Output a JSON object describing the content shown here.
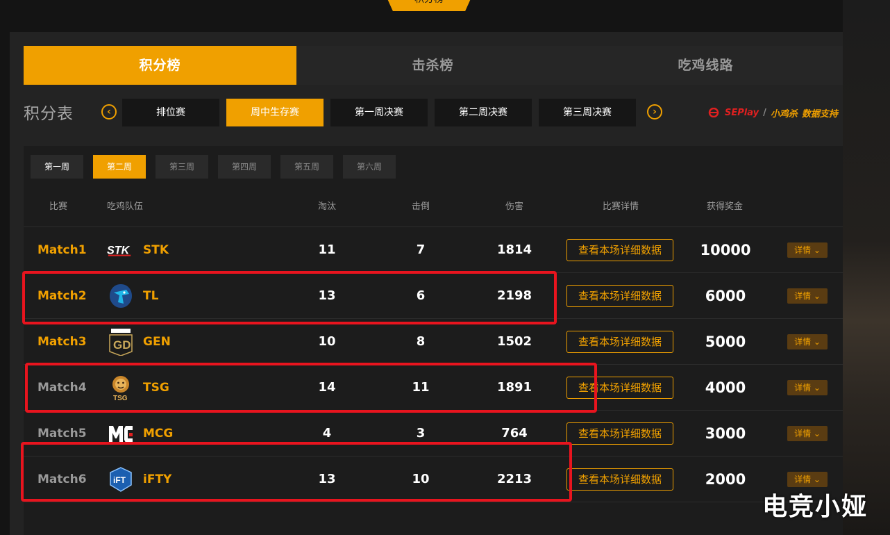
{
  "top_tab": {
    "label": "积分榜"
  },
  "main_tabs": [
    {
      "label": "积分榜",
      "active": true
    },
    {
      "label": "击杀榜",
      "active": false
    },
    {
      "label": "吃鸡线路",
      "active": false
    }
  ],
  "score_table": {
    "title": "积分表",
    "stage_tabs": [
      {
        "label": "排位赛",
        "active": false
      },
      {
        "label": "周中生存赛",
        "active": true
      },
      {
        "label": "第一周决赛",
        "active": false
      },
      {
        "label": "第二周决赛",
        "active": false
      },
      {
        "label": "第三周决赛",
        "active": false
      }
    ],
    "prev_icon": "chevron-left-icon",
    "next_icon": "chevron-right-icon",
    "sponsor": {
      "brand": "SEPlay",
      "partner": "小鸡杀",
      "tagline": "数据支持"
    }
  },
  "week_tabs": [
    {
      "label": "第一周",
      "active": false,
      "dim": false
    },
    {
      "label": "第二周",
      "active": true,
      "dim": false
    },
    {
      "label": "第三周",
      "active": false,
      "dim": true
    },
    {
      "label": "第四周",
      "active": false,
      "dim": true
    },
    {
      "label": "第五周",
      "active": false,
      "dim": true
    },
    {
      "label": "第六周",
      "active": false,
      "dim": true
    }
  ],
  "columns": {
    "match": "比赛",
    "team": "吃鸡队伍",
    "elim": "淘汰",
    "kill": "击倒",
    "damage": "伤害",
    "detail": "比赛详情",
    "prize": "获得奖金"
  },
  "rows": [
    {
      "match": "Match1",
      "team": "STK",
      "elim": "11",
      "kill": "7",
      "damage": "1814",
      "detail_label": "查看本场详细数据",
      "prize": "10000",
      "more_label": "详情 ⌄",
      "match_color": "gold",
      "logo": "stk-logo-icon"
    },
    {
      "match": "Match2",
      "team": "TL",
      "elim": "13",
      "kill": "6",
      "damage": "2198",
      "detail_label": "查看本场详细数据",
      "prize": "6000",
      "more_label": "详情 ⌄",
      "match_color": "gold",
      "logo": "tl-logo-icon"
    },
    {
      "match": "Match3",
      "team": "GEN",
      "elim": "10",
      "kill": "8",
      "damage": "1502",
      "detail_label": "查看本场详细数据",
      "prize": "5000",
      "more_label": "详情 ⌄",
      "match_color": "gold",
      "logo": "gen-logo-icon"
    },
    {
      "match": "Match4",
      "team": "TSG",
      "elim": "14",
      "kill": "11",
      "damage": "1891",
      "detail_label": "查看本场详细数据",
      "prize": "4000",
      "more_label": "详情 ⌄",
      "match_color": "grey",
      "logo": "tsg-logo-icon"
    },
    {
      "match": "Match5",
      "team": "MCG",
      "elim": "4",
      "kill": "3",
      "damage": "764",
      "detail_label": "查看本场详细数据",
      "prize": "3000",
      "more_label": "详情 ⌄",
      "match_color": "grey",
      "logo": "mcg-logo-icon"
    },
    {
      "match": "Match6",
      "team": "iFTY",
      "elim": "13",
      "kill": "10",
      "damage": "2213",
      "detail_label": "查看本场详细数据",
      "prize": "2000",
      "more_label": "详情 ⌄",
      "match_color": "grey",
      "logo": "ifty-logo-icon"
    }
  ],
  "watermark": "电竞小娅",
  "colors": {
    "accent": "#f0a000",
    "highlight": "#e8141e",
    "panel": "#232323"
  }
}
